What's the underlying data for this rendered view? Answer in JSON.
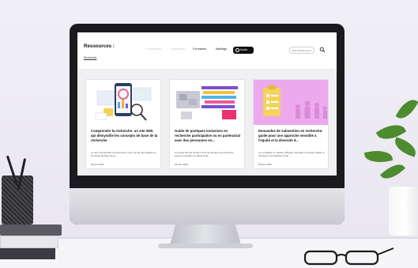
{
  "site": {
    "title": "Ressources :",
    "sublink": "Recherche"
  },
  "nav": {
    "items": [
      {
        "label": "Consultation"
      },
      {
        "label": "Facilitation"
      },
      {
        "label": "Formation"
      },
      {
        "label": "Maillage"
      }
    ],
    "audio_label": "Audio"
  },
  "search": {
    "placeholder": "Que cherchez-vous ?"
  },
  "cards": [
    {
      "title": "Comprendre la recherche: un site Web qui démystifie les concepts de base de la recherche",
      "desc": "Le site Comprendre la recherche a pour but de démystifier les concepts de base de la...",
      "date": "09 Oct 2023"
    },
    {
      "title": "Guide de pratiques inclusives en recherche participative ou en partenariat avec des personnes en...",
      "desc": "Ce guide aborde la façon dont les équipes de recherche peuvent travailler en partenariat...",
      "date": "29 Déc 2022"
    },
    {
      "title": "Demandes de subvention en recherche: guide pour une approche sensible à l'équité et la diversité d...",
      "desc": "Les mandats en matière d'Équité, diversité et inclusion (EDI) et d'analyse comparative fondé...",
      "date": "29 Déc 2022"
    }
  ],
  "colors": {
    "screen_bg": "#f0f0f2",
    "card3_thumb": "#e8a6e8",
    "audio_button": "#111111"
  }
}
